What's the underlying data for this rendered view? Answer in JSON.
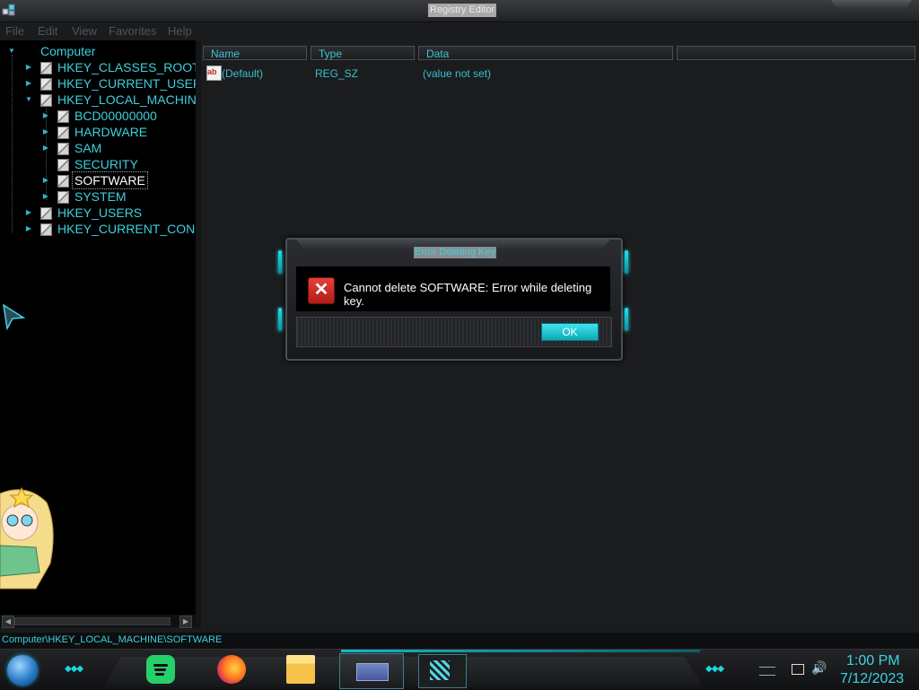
{
  "window": {
    "title": "Registry Editor"
  },
  "menu": [
    "File",
    "Edit",
    "View",
    "Favorites",
    "Help"
  ],
  "tree": {
    "root": "Computer",
    "hives": [
      "HKEY_CLASSES_ROOT",
      "HKEY_CURRENT_USER",
      "HKEY_LOCAL_MACHINE",
      "HKEY_USERS",
      "HKEY_CURRENT_CONFI"
    ],
    "hklm_children": [
      "BCD00000000",
      "HARDWARE",
      "SAM",
      "SECURITY",
      "SOFTWARE",
      "SYSTEM"
    ],
    "selected": "SOFTWARE"
  },
  "list": {
    "columns": [
      "Name",
      "Type",
      "Data"
    ],
    "rows": [
      {
        "name": "(Default)",
        "type": "REG_SZ",
        "data": "(value not set)"
      }
    ]
  },
  "dialog": {
    "title": "Error Deleting Key",
    "message": "Cannot delete SOFTWARE:  Error while deleting key.",
    "ok_label": "OK",
    "icon": "error-x-icon"
  },
  "status_bar": {
    "path": "Computer\\HKEY_LOCAL_MACHINE\\SOFTWARE"
  },
  "taskbar": {
    "apps": [
      "spotify-icon",
      "firefox-icon",
      "file-explorer-icon",
      "registry-editor-icon",
      "registry-editor-icon"
    ],
    "clock_time": "1:00 PM",
    "clock_date": "7/12/2023"
  },
  "theme": {
    "accent": "#38c8d6",
    "background": "#1a1b1d",
    "error_red": "#d0302b"
  }
}
